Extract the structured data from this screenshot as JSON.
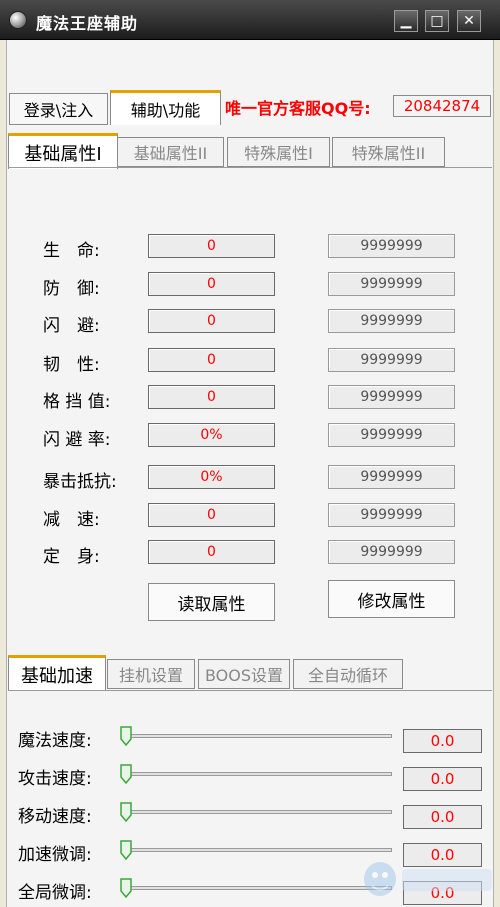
{
  "window": {
    "title": "魔法王座辅助",
    "controls": {
      "minimize": "▁",
      "maximize": "□",
      "close": "✕"
    }
  },
  "top_tabs": [
    {
      "label": "登录\\注入",
      "active": false
    },
    {
      "label": "辅助\\功能",
      "active": true
    }
  ],
  "support": {
    "label": "唯一官方客服QQ号:",
    "qq": "20842874"
  },
  "attr_tabs": [
    {
      "label": "基础属性I",
      "active": true
    },
    {
      "label": "基础属性II",
      "active": false
    },
    {
      "label": "特殊属性I",
      "active": false
    },
    {
      "label": "特殊属性II",
      "active": false
    }
  ],
  "attributes": [
    {
      "label": "生　命:",
      "value": "0",
      "target": "9999999"
    },
    {
      "label": "防　御:",
      "value": "0",
      "target": "9999999"
    },
    {
      "label": "闪　避:",
      "value": "0",
      "target": "9999999"
    },
    {
      "label": "韧　性:",
      "value": "0",
      "target": "9999999"
    },
    {
      "label": "格 挡 值:",
      "value": "0",
      "target": "9999999"
    },
    {
      "label": "闪 避 率:",
      "value": "0%",
      "target": "9999999"
    },
    {
      "label": "暴击抵抗:",
      "value": "0%",
      "target": "9999999"
    },
    {
      "label": "减　速:",
      "value": "0",
      "target": "9999999"
    },
    {
      "label": "定　身:",
      "value": "0",
      "target": "9999999"
    }
  ],
  "buttons": {
    "read": "读取属性",
    "modify": "修改属性"
  },
  "speed_tabs": [
    {
      "label": "基础加速",
      "active": true
    },
    {
      "label": "挂机设置",
      "active": false
    },
    {
      "label": "BOOS设置",
      "active": false
    },
    {
      "label": "全自动循环",
      "active": false
    }
  ],
  "speeds": [
    {
      "label": "魔法速度:",
      "value": "0.0",
      "level": 0
    },
    {
      "label": "攻击速度:",
      "value": "0.0",
      "level": 0
    },
    {
      "label": "移动速度:",
      "value": "0.0",
      "level": 0
    },
    {
      "label": "加速微调:",
      "value": "0.0",
      "level": 0
    },
    {
      "label": "全局微调:",
      "value": "0.0",
      "level": 0
    }
  ],
  "colors": {
    "accent_tab": "#e8a000",
    "value_red": "#ff0000",
    "slider_green": "#3aa83a"
  }
}
